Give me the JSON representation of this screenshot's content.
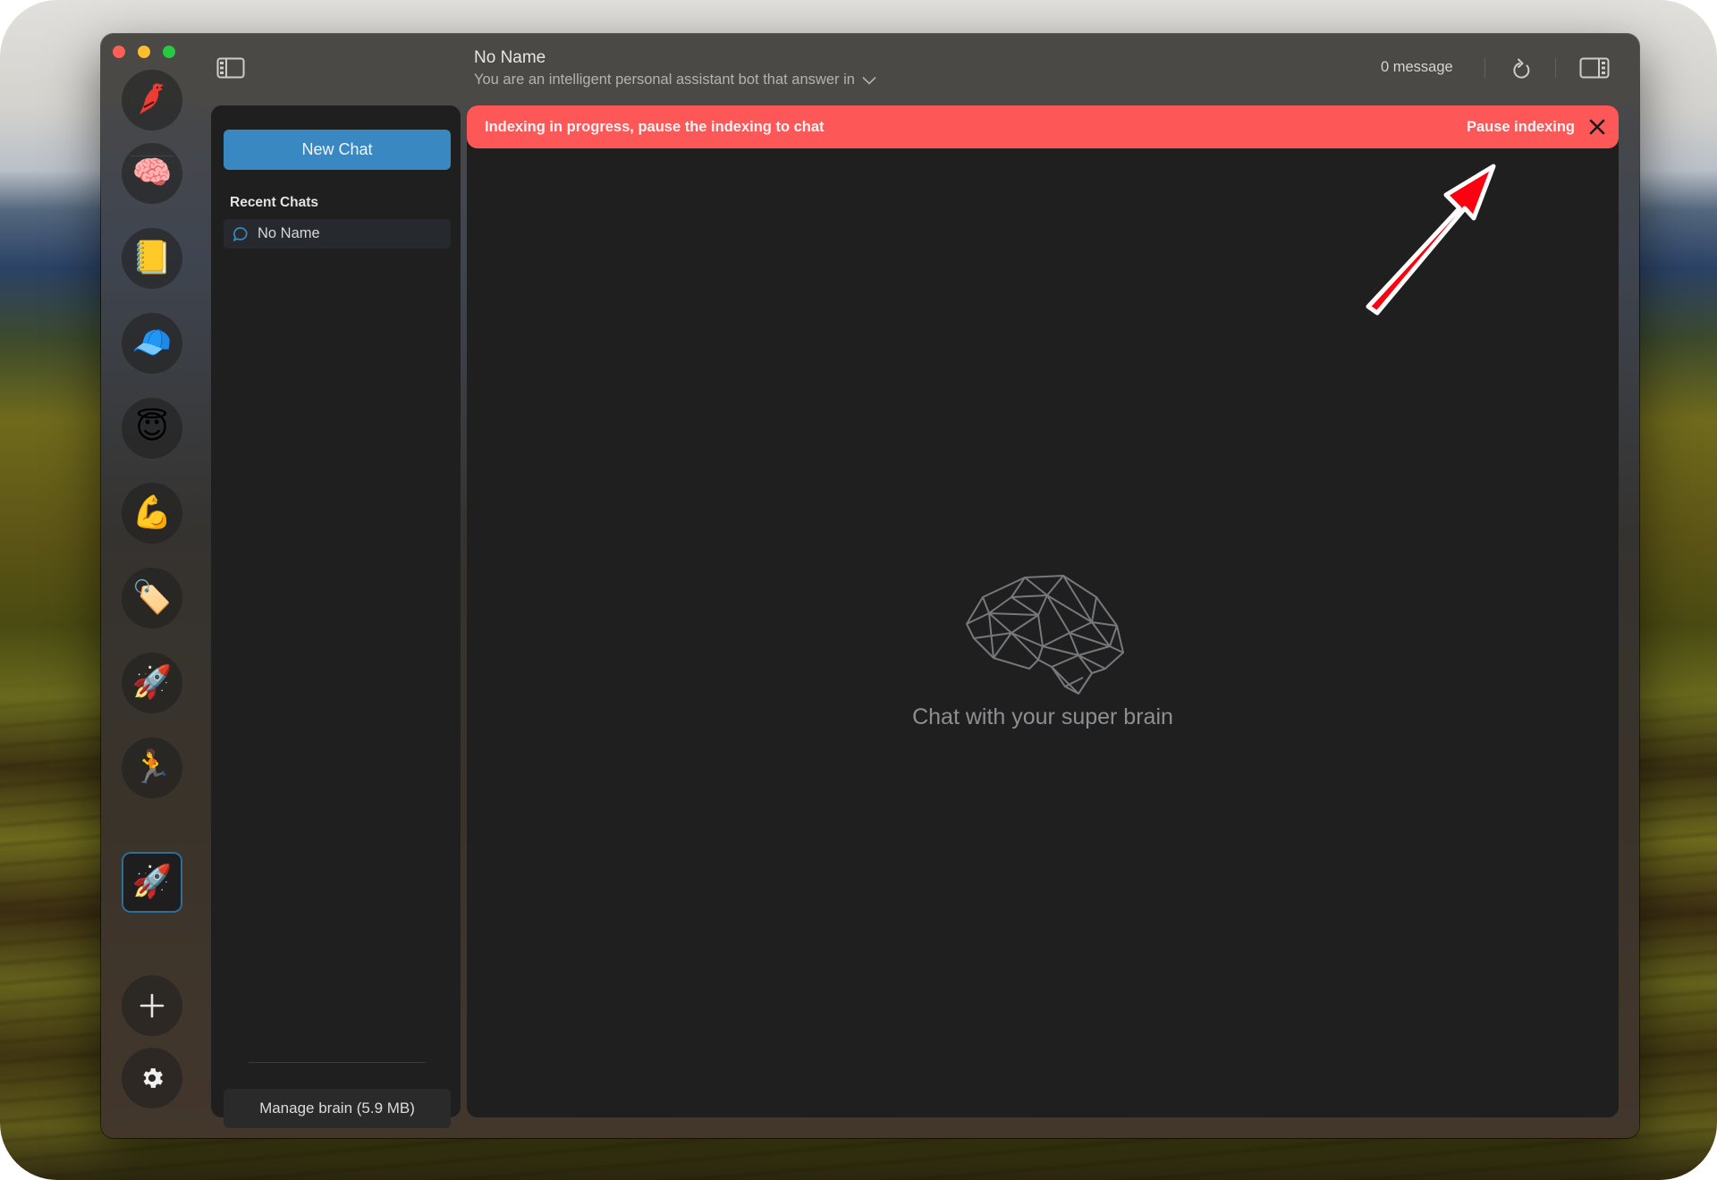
{
  "window": {
    "traffic_lights": [
      "close",
      "minimize",
      "maximize"
    ]
  },
  "rail": {
    "logo_icon": "cardinal-bird-icon",
    "brains": [
      {
        "name": "brain",
        "emoji": "🧠"
      },
      {
        "name": "notebook",
        "emoji": "📒"
      },
      {
        "name": "cap",
        "emoji": "🧢"
      },
      {
        "name": "halo-smile",
        "emoji": "😇"
      },
      {
        "name": "flexed-biceps",
        "emoji": "💪"
      },
      {
        "name": "tag-note",
        "emoji": "🏷️"
      },
      {
        "name": "rocket",
        "emoji": "🚀"
      },
      {
        "name": "runner",
        "emoji": "🏃"
      },
      {
        "name": "rocket-active",
        "emoji": "🚀",
        "active": true
      }
    ],
    "add_icon": "plus-icon",
    "settings_icon": "gear-icon"
  },
  "header": {
    "title": "No Name",
    "subtitle": "You are an intelligent personal assistant bot that answer in",
    "message_count": "0 message"
  },
  "sidepanel": {
    "new_chat_label": "New Chat",
    "recent_label": "Recent Chats",
    "chats": [
      {
        "label": "No Name",
        "selected": true
      }
    ],
    "manage_brain_label": "Manage brain (5.9 MB)"
  },
  "banner": {
    "text": "Indexing in progress, pause the indexing to chat",
    "action_label": "Pause indexing",
    "color": "#fd5757"
  },
  "main": {
    "empty_state_text": "Chat with your super brain"
  },
  "colors": {
    "accent": "#3a88c2",
    "annotation_arrow": "#ff0010"
  }
}
